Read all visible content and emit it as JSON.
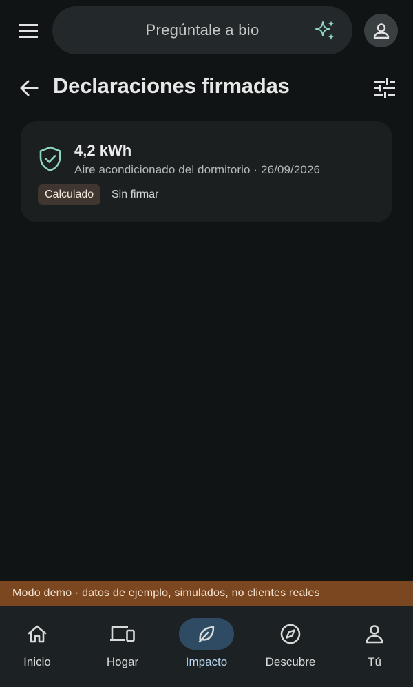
{
  "search": {
    "placeholder": "Pregúntale a bio"
  },
  "header": {
    "title": "Declaraciones firmadas"
  },
  "card": {
    "value": "4,2 kWh",
    "subtitle": "Aire acondicionado del dormitorio · 26/09/2026",
    "badge": "Calculado",
    "status": "Sin firmar"
  },
  "banner": {
    "text": "Modo demo · datos de ejemplo, simulados, no clientes reales"
  },
  "nav": {
    "items": [
      {
        "label": "Inicio",
        "icon": "home-icon"
      },
      {
        "label": "Hogar",
        "icon": "devices-icon"
      },
      {
        "label": "Impacto",
        "icon": "leaf-icon",
        "active": true
      },
      {
        "label": "Descubre",
        "icon": "compass-icon"
      },
      {
        "label": "Tú",
        "icon": "person-icon"
      }
    ]
  },
  "colors": {
    "background": "#111414",
    "accent_green": "#8fd6c0",
    "nav_active": "#2e4b63",
    "banner": "#7b4720"
  }
}
